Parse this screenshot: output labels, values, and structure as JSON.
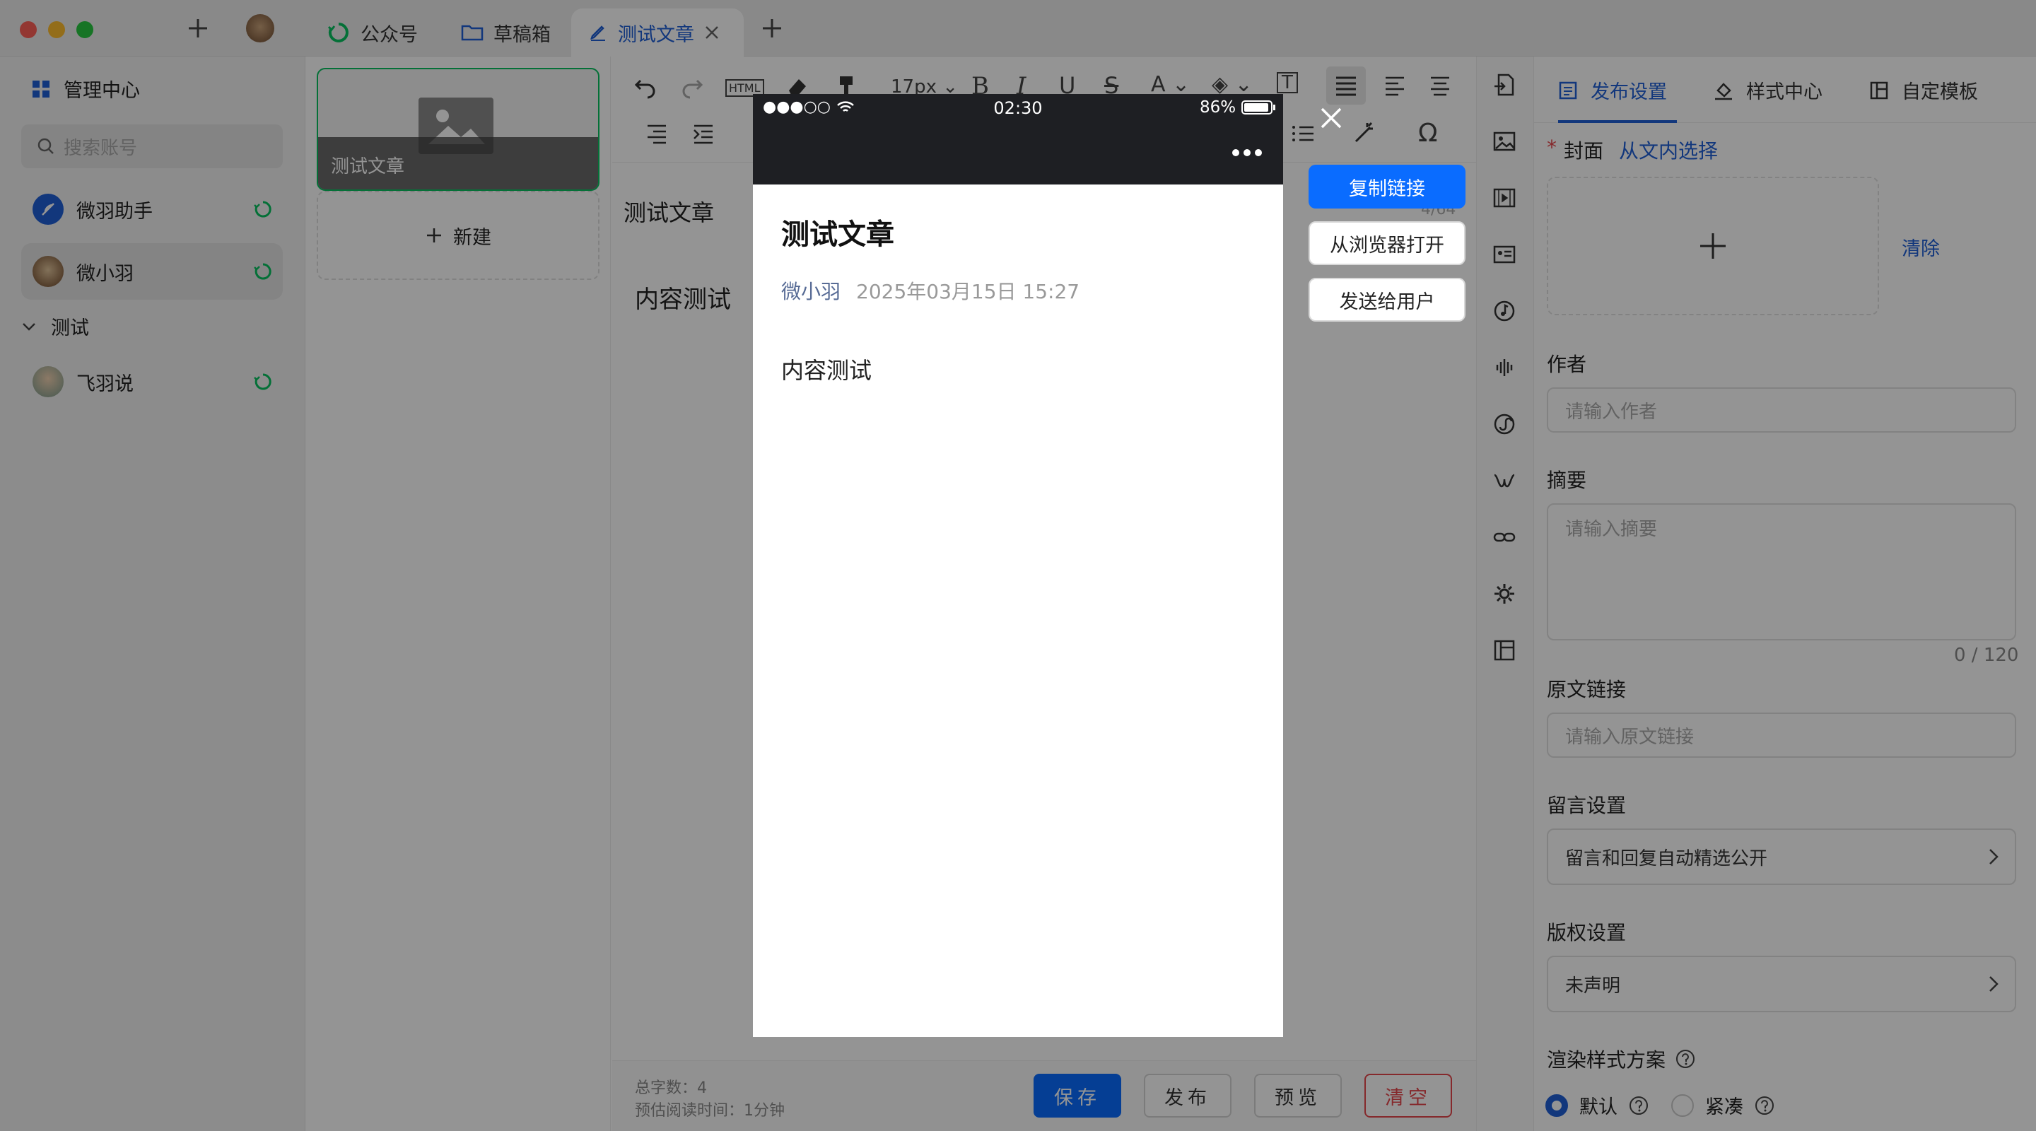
{
  "window": {
    "tabs": [
      {
        "label": "公众号"
      },
      {
        "label": "草稿箱"
      },
      {
        "label": "测试文章"
      }
    ]
  },
  "sidebar": {
    "title": "管理中心",
    "search_placeholder": "搜索账号",
    "accounts": [
      {
        "name": "微羽助手"
      },
      {
        "name": "微小羽"
      }
    ],
    "group": {
      "name": "测试",
      "accounts": [
        {
          "name": "飞羽说"
        }
      ]
    }
  },
  "articles": {
    "items": [
      {
        "title": "测试文章"
      }
    ],
    "new_label": "新建"
  },
  "editor": {
    "font_size": "17px",
    "title": "测试文章",
    "title_count": "4/64",
    "body": "内容测试",
    "stats": {
      "total_words": "总字数：4",
      "read_time": "预估阅读时间：1分钟"
    },
    "buttons": {
      "save": "保存",
      "publish": "发布",
      "preview": "预览",
      "clear": "清空"
    }
  },
  "settings": {
    "tabs": [
      {
        "label": "发布设置"
      },
      {
        "label": "样式中心"
      },
      {
        "label": "自定模板"
      }
    ],
    "cover": {
      "required_mark": "*",
      "label": "封面",
      "from_content": "从文内选择",
      "clear": "清除"
    },
    "author": {
      "label": "作者",
      "placeholder": "请输入作者"
    },
    "summary": {
      "label": "摘要",
      "placeholder": "请输入摘要",
      "count": "0 / 120"
    },
    "source_link": {
      "label": "原文链接",
      "placeholder": "请输入原文链接"
    },
    "comments": {
      "label": "留言设置",
      "value": "留言和回复自动精选公开"
    },
    "copyright": {
      "label": "版权设置",
      "value": "未声明"
    },
    "render": {
      "label": "渲染样式方案",
      "options": [
        {
          "label": "默认",
          "selected": true
        },
        {
          "label": "紧凑",
          "selected": false
        }
      ]
    }
  },
  "preview": {
    "status": {
      "signal": "●●●○○",
      "time": "02:30",
      "battery": "86%"
    },
    "menu_icon": "more-dots-icon",
    "article": {
      "title": "测试文章",
      "author": "微小羽",
      "date": "2025年03月15日 15:27",
      "body": "内容测试"
    },
    "actions": {
      "copy_link": "复制链接",
      "open_browser": "从浏览器打开",
      "send_user": "发送给用户"
    }
  },
  "colors": {
    "accent": "#0a6cff",
    "link": "#1f5fd6",
    "danger": "#e5484d",
    "wechat_green": "#07c160"
  }
}
